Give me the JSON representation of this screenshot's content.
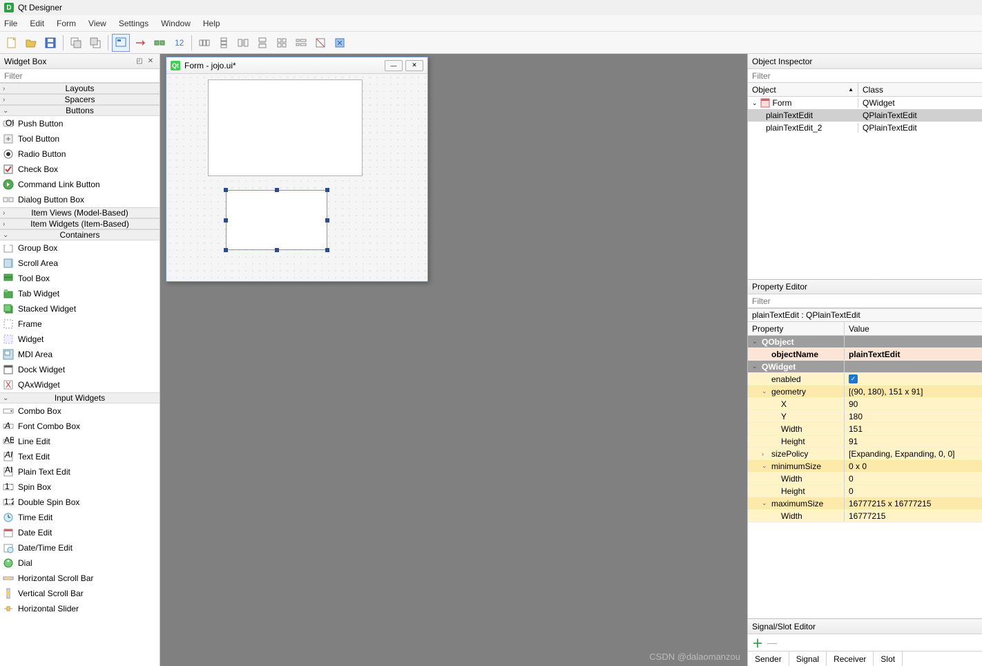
{
  "app": {
    "title": "Qt Designer"
  },
  "menu": [
    "File",
    "Edit",
    "Form",
    "View",
    "Settings",
    "Window",
    "Help"
  ],
  "widgetbox": {
    "title": "Widget Box",
    "filter_placeholder": "Filter",
    "categories": [
      {
        "name": "Layouts",
        "expanded": false,
        "items": []
      },
      {
        "name": "Spacers",
        "expanded": false,
        "items": []
      },
      {
        "name": "Buttons",
        "expanded": true,
        "items": [
          {
            "label": "Push Button",
            "icon": "pushbutton"
          },
          {
            "label": "Tool Button",
            "icon": "toolbutton"
          },
          {
            "label": "Radio Button",
            "icon": "radio"
          },
          {
            "label": "Check Box",
            "icon": "checkbox"
          },
          {
            "label": "Command Link Button",
            "icon": "commandlink"
          },
          {
            "label": "Dialog Button Box",
            "icon": "dialogbuttonbox"
          }
        ]
      },
      {
        "name": "Item Views (Model-Based)",
        "expanded": false,
        "items": []
      },
      {
        "name": "Item Widgets (Item-Based)",
        "expanded": false,
        "items": []
      },
      {
        "name": "Containers",
        "expanded": true,
        "items": [
          {
            "label": "Group Box",
            "icon": "groupbox"
          },
          {
            "label": "Scroll Area",
            "icon": "scrollarea"
          },
          {
            "label": "Tool Box",
            "icon": "toolbox"
          },
          {
            "label": "Tab Widget",
            "icon": "tabwidget"
          },
          {
            "label": "Stacked Widget",
            "icon": "stacked"
          },
          {
            "label": "Frame",
            "icon": "frame"
          },
          {
            "label": "Widget",
            "icon": "widget"
          },
          {
            "label": "MDI Area",
            "icon": "mdi"
          },
          {
            "label": "Dock Widget",
            "icon": "dock"
          },
          {
            "label": "QAxWidget",
            "icon": "ax"
          }
        ]
      },
      {
        "name": "Input Widgets",
        "expanded": true,
        "items": [
          {
            "label": "Combo Box",
            "icon": "combo"
          },
          {
            "label": "Font Combo Box",
            "icon": "fontcombo"
          },
          {
            "label": "Line Edit",
            "icon": "lineedit"
          },
          {
            "label": "Text Edit",
            "icon": "textedit"
          },
          {
            "label": "Plain Text Edit",
            "icon": "plaintext"
          },
          {
            "label": "Spin Box",
            "icon": "spin"
          },
          {
            "label": "Double Spin Box",
            "icon": "dspin"
          },
          {
            "label": "Time Edit",
            "icon": "time"
          },
          {
            "label": "Date Edit",
            "icon": "date"
          },
          {
            "label": "Date/Time Edit",
            "icon": "datetime"
          },
          {
            "label": "Dial",
            "icon": "dial"
          },
          {
            "label": "Horizontal Scroll Bar",
            "icon": "hscroll"
          },
          {
            "label": "Vertical Scroll Bar",
            "icon": "vscroll"
          },
          {
            "label": "Horizontal Slider",
            "icon": "hslider"
          }
        ]
      }
    ]
  },
  "form": {
    "title": "Form - jojo.ui*"
  },
  "objectInspector": {
    "title": "Object Inspector",
    "filter_placeholder": "Filter",
    "columns": [
      "Object",
      "Class"
    ],
    "tree": [
      {
        "object": "Form",
        "class": "QWidget",
        "level": 0,
        "expanded": true,
        "icon": "form"
      },
      {
        "object": "plainTextEdit",
        "class": "QPlainTextEdit",
        "level": 1,
        "selected": true
      },
      {
        "object": "plainTextEdit_2",
        "class": "QPlainTextEdit",
        "level": 1
      }
    ]
  },
  "propertyEditor": {
    "title": "Property Editor",
    "filter_placeholder": "Filter",
    "objectLine": "plainTextEdit : QPlainTextEdit",
    "columns": [
      "Property",
      "Value"
    ],
    "rows": [
      {
        "type": "group",
        "name": "QObject"
      },
      {
        "type": "prop",
        "name": "objectName",
        "value": "plainTextEdit",
        "style": "objname",
        "indent": 1
      },
      {
        "type": "group",
        "name": "QWidget"
      },
      {
        "type": "prop",
        "name": "enabled",
        "value": "check",
        "style": "hl2",
        "indent": 1
      },
      {
        "type": "prop",
        "name": "geometry",
        "value": "[(90, 180), 151 x 91]",
        "style": "hl",
        "indent": 1,
        "chev": "v"
      },
      {
        "type": "prop",
        "name": "X",
        "value": "90",
        "style": "hl2",
        "indent": 2
      },
      {
        "type": "prop",
        "name": "Y",
        "value": "180",
        "style": "hl2",
        "indent": 2
      },
      {
        "type": "prop",
        "name": "Width",
        "value": "151",
        "style": "hl2",
        "indent": 2
      },
      {
        "type": "prop",
        "name": "Height",
        "value": "91",
        "style": "hl2",
        "indent": 2
      },
      {
        "type": "prop",
        "name": "sizePolicy",
        "value": "[Expanding, Expanding, 0, 0]",
        "style": "hl2",
        "indent": 1,
        "chev": ">"
      },
      {
        "type": "prop",
        "name": "minimumSize",
        "value": "0 x 0",
        "style": "hl",
        "indent": 1,
        "chev": "v"
      },
      {
        "type": "prop",
        "name": "Width",
        "value": "0",
        "style": "hl2",
        "indent": 2
      },
      {
        "type": "prop",
        "name": "Height",
        "value": "0",
        "style": "hl2",
        "indent": 2
      },
      {
        "type": "prop",
        "name": "maximumSize",
        "value": "16777215 x 16777215",
        "style": "hl",
        "indent": 1,
        "chev": "v"
      },
      {
        "type": "prop",
        "name": "Width",
        "value": "16777215",
        "style": "hl2",
        "indent": 2
      }
    ]
  },
  "signalSlot": {
    "title": "Signal/Slot Editor",
    "columns": [
      "Sender",
      "Signal",
      "Receiver",
      "Slot"
    ]
  },
  "watermark": "CSDN @dalaomanzou"
}
